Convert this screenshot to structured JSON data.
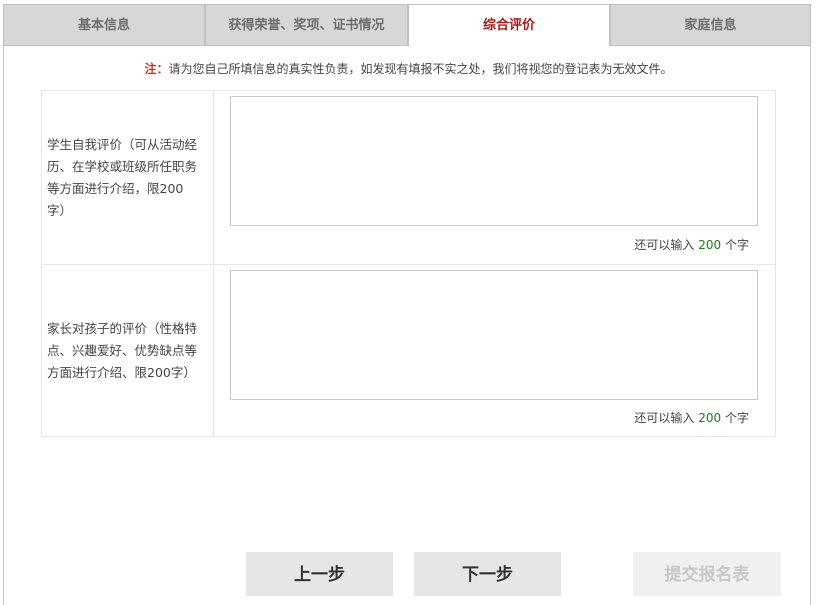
{
  "tabs": [
    {
      "label": "基本信息"
    },
    {
      "label": "获得荣誉、奖项、证书情况"
    },
    {
      "label": "综合评价"
    },
    {
      "label": "家庭信息"
    }
  ],
  "notice": {
    "label": "注：",
    "text": "请为您自己所填信息的真实性负责，如发现有填报不实之处，我们将视您的登记表为无效文件。"
  },
  "fields": [
    {
      "label": "学生自我评价（可从活动经历、在学校或班级所任职务等方面进行介绍，限200字）",
      "value": "",
      "counter_prefix": "还可以输入",
      "counter_value": "200",
      "counter_suffix": "个字"
    },
    {
      "label": "家长对孩子的评价（性格特点、兴趣爱好、优势缺点等方面进行介绍、限200字）",
      "value": "",
      "counter_prefix": "还可以输入",
      "counter_value": "200",
      "counter_suffix": "个字"
    }
  ],
  "buttons": {
    "prev": "上一步",
    "next": "下一步",
    "submit": "提交报名表"
  },
  "colors": {
    "active_tab": "#a81a1a",
    "counter_number": "#1c7d1c",
    "notice_label": "#c0392b"
  }
}
